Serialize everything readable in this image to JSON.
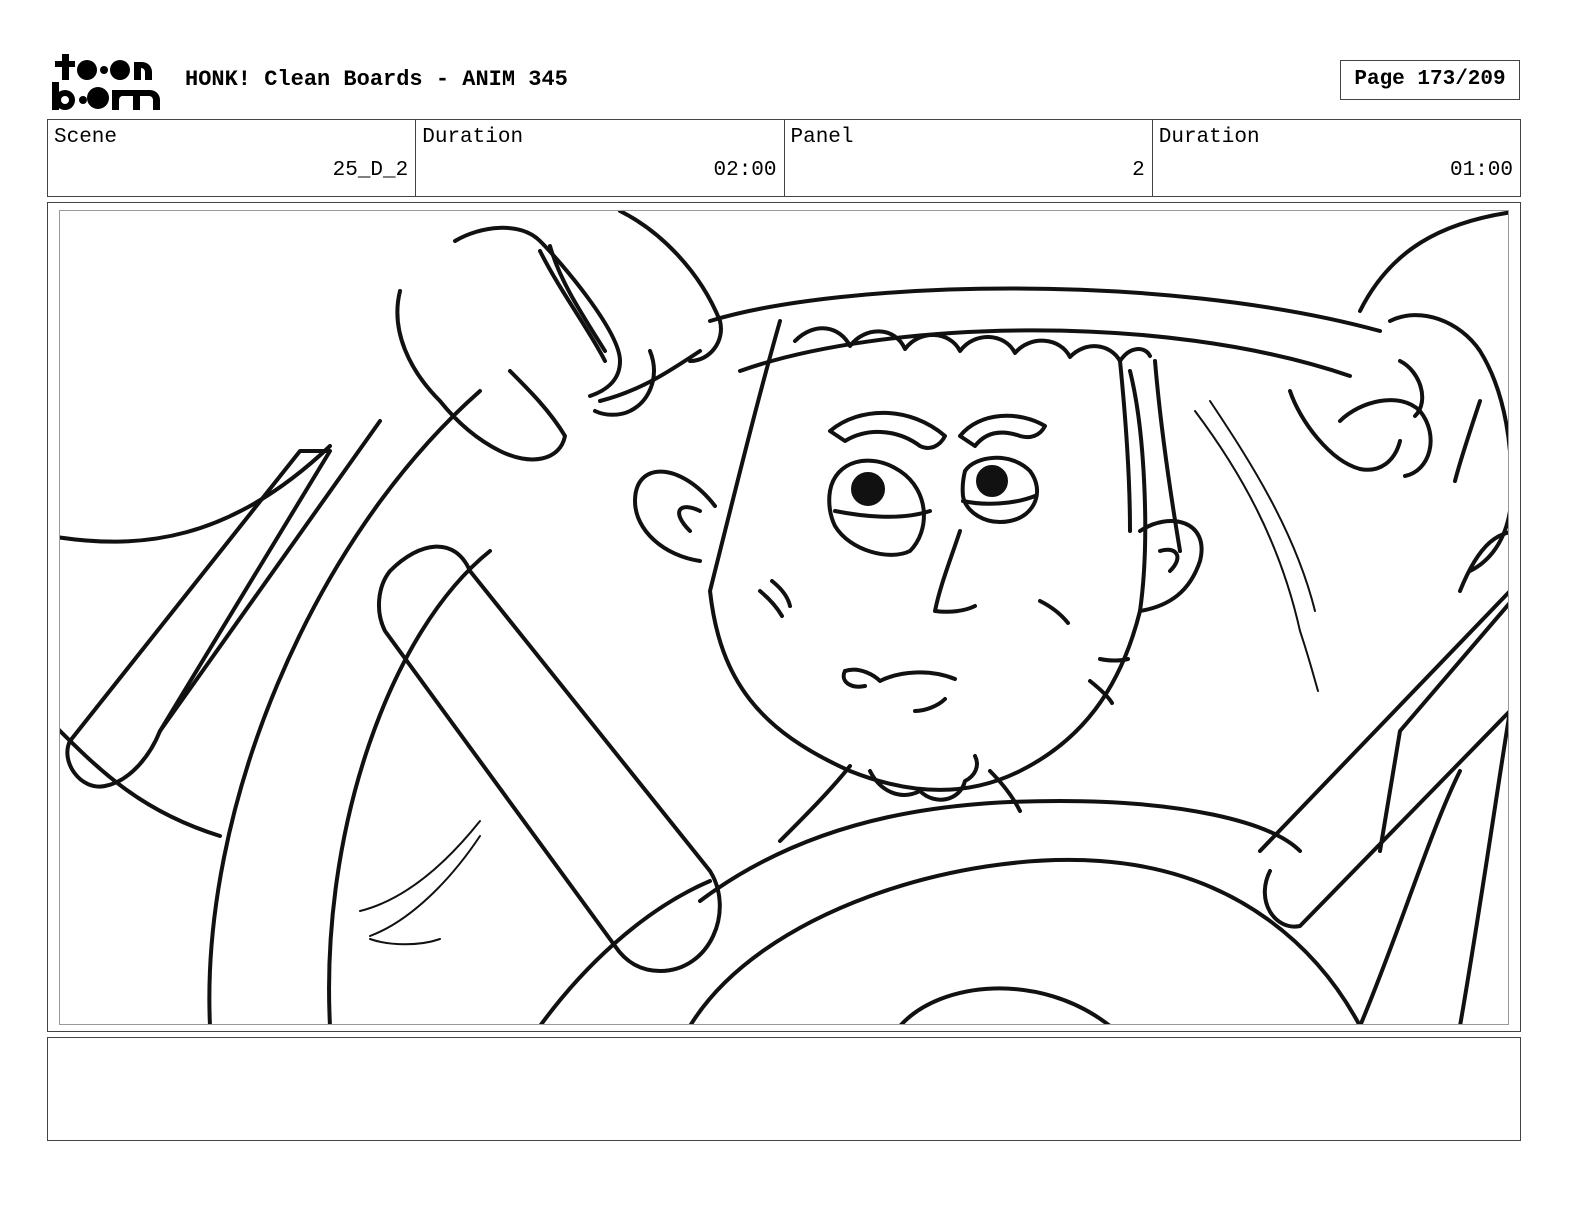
{
  "header": {
    "logo_text": "toon boom",
    "title": "HONK! Clean Boards - ANIM 345",
    "page_label": "Page 173/209"
  },
  "info": {
    "scene_label": "Scene",
    "scene_value": "25_D_2",
    "scene_duration_label": "Duration",
    "scene_duration_value": "02:00",
    "panel_label": "Panel",
    "panel_value": "2",
    "panel_duration_label": "Duration",
    "panel_duration_value": "01:00"
  },
  "panel": {
    "drawing": "line-art-driver-gripping-steering-wheel"
  },
  "notes": {
    "text": ""
  }
}
